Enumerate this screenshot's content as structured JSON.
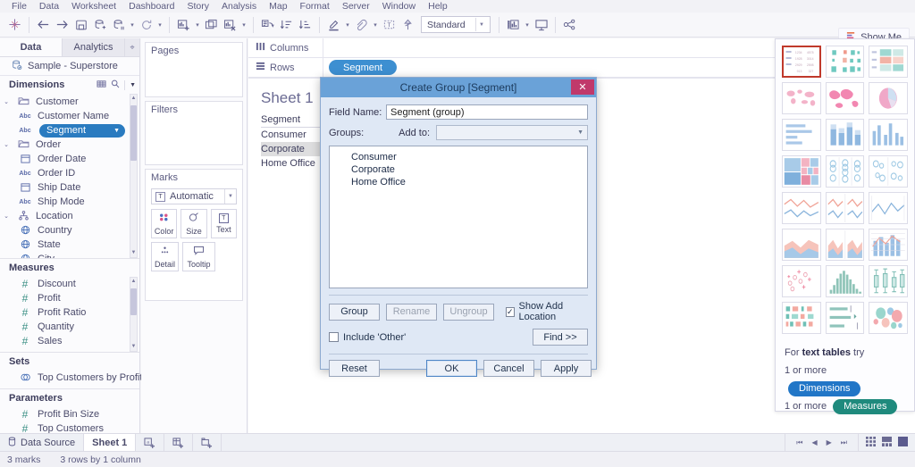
{
  "menubar": {
    "items": [
      "File",
      "Data",
      "Worksheet",
      "Dashboard",
      "Story",
      "Analysis",
      "Map",
      "Format",
      "Server",
      "Window",
      "Help"
    ]
  },
  "toolbar": {
    "fit_value": "Standard",
    "show_me_label": "Show Me",
    "icons": [
      "tableau-logo-icon",
      "back-icon",
      "forward-icon",
      "save-icon",
      "new-data-source-icon",
      "pause-refresh-icon",
      "refresh-icon",
      "new-worksheet-icon",
      "duplicate-sheet-icon",
      "clear-sheet-icon",
      "swap-rows-columns-icon",
      "sort-ascending-icon",
      "sort-descending-icon",
      "highlight-icon",
      "group-members-icon",
      "show-mark-labels-icon",
      "fix-axes-icon",
      "presentation-mode-icon",
      "share-icon"
    ]
  },
  "sidebar": {
    "tabs": [
      {
        "label": "Data",
        "active": true
      },
      {
        "label": "Analytics",
        "active": false
      }
    ],
    "datasource": {
      "label": "Sample - Superstore",
      "icon": "data-source-icon"
    },
    "dimensions": {
      "header": "Dimensions",
      "items": [
        {
          "label": "Customer",
          "icon": "folder-icon",
          "level": 1,
          "type": "folder"
        },
        {
          "label": "Customer Name",
          "icon": "abc-icon",
          "level": 2,
          "type": "string"
        },
        {
          "label": "Segment",
          "icon": "abc-icon",
          "level": 2,
          "type": "string",
          "selected": true
        },
        {
          "label": "Order",
          "icon": "folder-icon",
          "level": 1,
          "type": "folder"
        },
        {
          "label": "Order Date",
          "icon": "date-icon",
          "level": 2,
          "type": "date"
        },
        {
          "label": "Order ID",
          "icon": "abc-icon",
          "level": 2,
          "type": "string"
        },
        {
          "label": "Ship Date",
          "icon": "date-icon",
          "level": 2,
          "type": "date"
        },
        {
          "label": "Ship Mode",
          "icon": "abc-icon",
          "level": 2,
          "type": "string"
        },
        {
          "label": "Location",
          "icon": "hierarchy-icon",
          "level": 1,
          "type": "hierarchy"
        },
        {
          "label": "Country",
          "icon": "geo-icon",
          "level": 2,
          "type": "geo"
        },
        {
          "label": "State",
          "icon": "geo-icon",
          "level": 2,
          "type": "geo"
        },
        {
          "label": "City",
          "icon": "geo-icon",
          "level": 2,
          "type": "geo"
        }
      ]
    },
    "measures": {
      "header": "Measures",
      "items": [
        {
          "label": "Discount",
          "icon": "number-icon"
        },
        {
          "label": "Profit",
          "icon": "number-icon"
        },
        {
          "label": "Profit Ratio",
          "icon": "calculated-number-icon"
        },
        {
          "label": "Quantity",
          "icon": "number-icon"
        },
        {
          "label": "Sales",
          "icon": "number-icon"
        }
      ]
    },
    "sets": {
      "header": "Sets",
      "items": [
        {
          "label": "Top Customers by Profit",
          "icon": "set-icon"
        }
      ]
    },
    "parameters": {
      "header": "Parameters",
      "items": [
        {
          "label": "Profit Bin Size",
          "icon": "number-icon"
        },
        {
          "label": "Top Customers",
          "icon": "number-icon"
        }
      ]
    }
  },
  "worksheet": {
    "pages_label": "Pages",
    "filters_label": "Filters",
    "marks_label": "Marks",
    "marks_type": "Automatic",
    "marks_buttons": [
      {
        "label": "Color",
        "icon": "color-icon"
      },
      {
        "label": "Size",
        "icon": "size-icon"
      },
      {
        "label": "Text",
        "icon": "text-icon"
      },
      {
        "label": "Detail",
        "icon": "detail-icon"
      },
      {
        "label": "Tooltip",
        "icon": "tooltip-icon"
      }
    ],
    "columns_label": "Columns",
    "rows_label": "Rows",
    "rows_pills": [
      "Segment"
    ],
    "columns_pills": [],
    "sheet_title": "Sheet 1",
    "table": {
      "header": "Segment",
      "rows": [
        "Consumer",
        "Corporate",
        "Home Office"
      ],
      "selected_row": "Corporate"
    }
  },
  "dialog": {
    "title": "Create Group [Segment]",
    "close_label": "✕",
    "field_name_label": "Field Name:",
    "field_name_value": "Segment (group)",
    "groups_label": "Groups:",
    "add_to_label": "Add to:",
    "add_to_value": "",
    "list_items": [
      "Consumer",
      "Corporate",
      "Home Office"
    ],
    "group_button": "Group",
    "rename_button": "Rename",
    "ungroup_button": "Ungroup",
    "show_add_location_label": "Show Add Location",
    "show_add_location_checked": true,
    "include_other_label": "Include 'Other'",
    "include_other_checked": false,
    "find_button": "Find >>",
    "reset_button": "Reset",
    "ok_button": "OK",
    "cancel_button": "Cancel",
    "apply_button": "Apply"
  },
  "show_me": {
    "footer_prefix": "For",
    "footer_strong": "text tables",
    "footer_suffix": "try",
    "rows": [
      {
        "prefix": "1 or more",
        "chip": "Dimensions",
        "chip_type": "dimension"
      },
      {
        "prefix": "1 or more",
        "chip": "Measures",
        "chip_type": "measure"
      }
    ],
    "thumbs": [
      {
        "name": "text-table-thumb",
        "selected": true
      },
      {
        "name": "heat-map-thumb",
        "selected": false
      },
      {
        "name": "highlight-table-thumb",
        "selected": false
      },
      {
        "name": "symbol-map-thumb",
        "selected": false
      },
      {
        "name": "filled-map-thumb",
        "selected": false
      },
      {
        "name": "pie-chart-thumb",
        "selected": false
      },
      {
        "name": "horizontal-bar-thumb",
        "selected": false
      },
      {
        "name": "stacked-bar-thumb",
        "selected": false
      },
      {
        "name": "side-by-side-bar-thumb",
        "selected": false
      },
      {
        "name": "treemap-thumb",
        "selected": false
      },
      {
        "name": "circle-view-thumb",
        "selected": false
      },
      {
        "name": "side-by-side-circle-thumb",
        "selected": false
      },
      {
        "name": "line-continuous-thumb",
        "selected": false
      },
      {
        "name": "line-discrete-thumb",
        "selected": false
      },
      {
        "name": "dual-line-thumb",
        "selected": false
      },
      {
        "name": "area-continuous-thumb",
        "selected": false
      },
      {
        "name": "area-discrete-thumb",
        "selected": false
      },
      {
        "name": "dual-combination-thumb",
        "selected": false
      },
      {
        "name": "scatter-plot-thumb",
        "selected": false
      },
      {
        "name": "histogram-thumb",
        "selected": false
      },
      {
        "name": "box-plot-thumb",
        "selected": false
      },
      {
        "name": "gantt-thumb",
        "selected": false
      },
      {
        "name": "bullet-graph-thumb",
        "selected": false
      },
      {
        "name": "packed-bubbles-thumb",
        "selected": false
      }
    ]
  },
  "bottom": {
    "tabs": [
      {
        "label": "Data Source",
        "icon": "data-source-tab-icon",
        "active": false
      },
      {
        "label": "Sheet 1",
        "icon": "",
        "active": true
      }
    ],
    "new_buttons": [
      "new-worksheet-icon",
      "new-dashboard-icon",
      "new-story-icon"
    ],
    "nav": [
      "first-icon",
      "prev-icon",
      "next-icon",
      "last-icon"
    ],
    "view_modes": [
      "show-filmstrip-icon",
      "show-sheet-sorter-icon",
      "show-worksheet-icon"
    ],
    "status": {
      "marks": "3 marks",
      "dimensions": "3 rows by 1 column"
    }
  },
  "colors": {
    "accent_blue": "#2a7bc0",
    "pill_blue": "#3d8fd1",
    "dialog_title": "#6aa2d8",
    "close_red": "#c0396b",
    "measure_green": "#1f8a7d",
    "selected_border": "#c0392b"
  }
}
